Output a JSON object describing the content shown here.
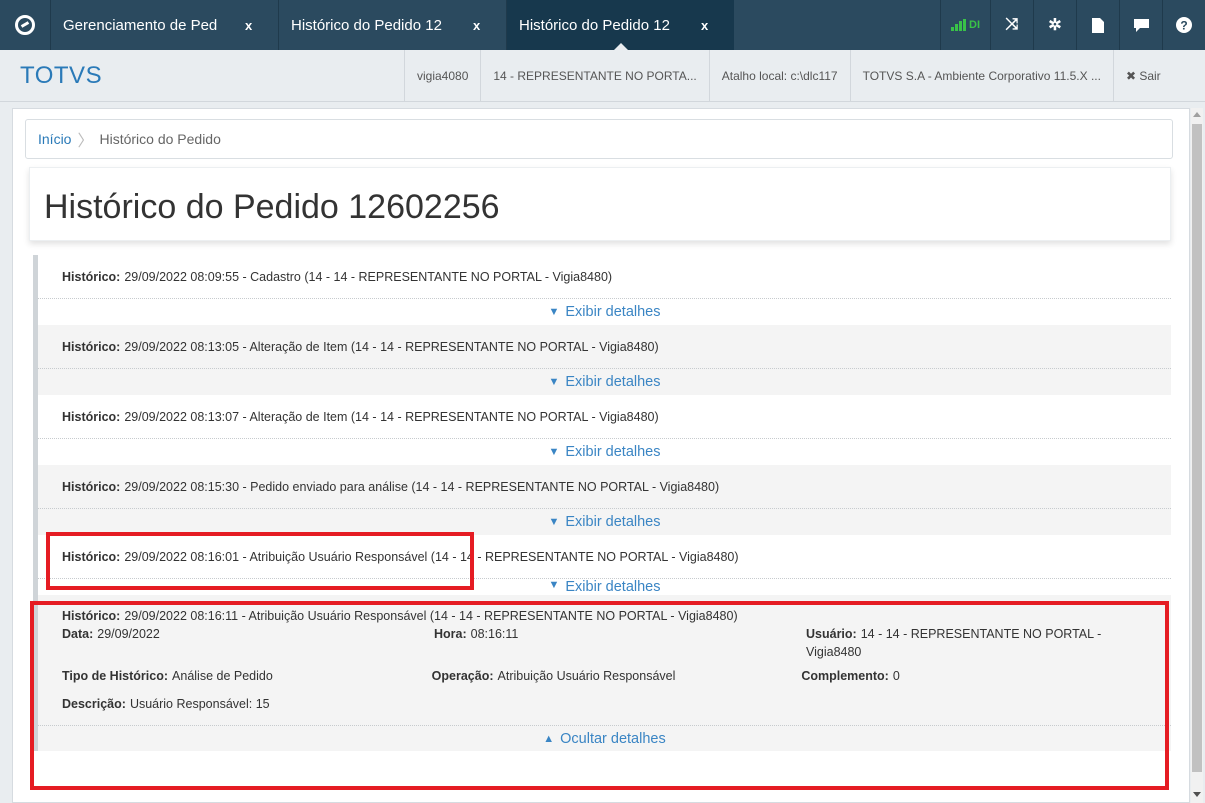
{
  "tabs": [
    {
      "label": "Gerenciamento de Ped",
      "close": "x",
      "active": false
    },
    {
      "label": "Histórico do Pedido 12",
      "close": "x",
      "active": false
    },
    {
      "label": "Histórico do Pedido 12",
      "close": "x",
      "active": true
    }
  ],
  "top_icons": {
    "signal_label": "DI",
    "icons": [
      "signal-icon",
      "shuffle-icon",
      "gear-icon",
      "document-icon",
      "chat-icon",
      "help-icon"
    ]
  },
  "infobar": {
    "brand": "TOTVS",
    "user": "vigia4080",
    "representative": "14 - REPRESENTANTE NO PORTA...",
    "shortcut": "Atalho local: c:\\dlc117",
    "environment": "TOTVS S.A - Ambiente Corporativo 11.5.X ...",
    "exit": "✖ Sair"
  },
  "breadcrumb": {
    "home": "Início",
    "current": "Histórico do Pedido"
  },
  "page_title": "Histórico do Pedido 12602256",
  "history_label": "Histórico:",
  "show_details": "Exibir detalhes",
  "hide_details": "Ocultar detalhes",
  "history": [
    {
      "text": "29/09/2022 08:09:55 - Cadastro (14 - 14 - REPRESENTANTE NO PORTAL - Vigia8480)"
    },
    {
      "text": "29/09/2022 08:13:05 - Alteração de Item (14 - 14 - REPRESENTANTE NO PORTAL - Vigia8480)"
    },
    {
      "text": "29/09/2022 08:13:07 - Alteração de Item (14 - 14 - REPRESENTANTE NO PORTAL - Vigia8480)"
    },
    {
      "text": "29/09/2022 08:15:30 - Pedido enviado para análise (14 - 14 - REPRESENTANTE NO PORTAL - Vigia8480)"
    },
    {
      "text": "29/09/2022 08:16:01 - Atribuição Usuário Responsável (14 - 14 - REPRESENTANTE NO PORTAL - Vigia8480)"
    },
    {
      "text": "29/09/2022 08:16:11 - Atribuição Usuário Responsável (14 - 14 - REPRESENTANTE NO PORTAL - Vigia8480)"
    }
  ],
  "details": {
    "data_label": "Data:",
    "data_value": "29/09/2022",
    "hora_label": "Hora:",
    "hora_value": "08:16:11",
    "usuario_label": "Usuário:",
    "usuario_value": "14 - 14 - REPRESENTANTE NO PORTAL - Vigia8480",
    "tipo_label": "Tipo de Histórico:",
    "tipo_value": "Análise de Pedido",
    "operacao_label": "Operação:",
    "operacao_value": "Atribuição Usuário Responsável",
    "complemento_label": "Complemento:",
    "complemento_value": "0",
    "descricao_label": "Descrição:",
    "descricao_value": "Usuário Responsável: 15"
  },
  "colors": {
    "accent": "#2a7ab8",
    "topbar": "#2b4a5f",
    "highlight": "#e51c23",
    "signal": "#39c248"
  }
}
